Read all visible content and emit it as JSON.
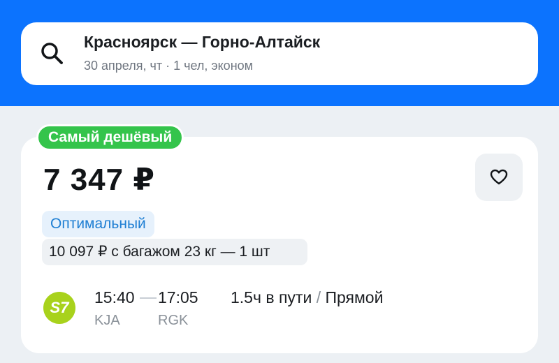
{
  "search": {
    "route": "Красноярск — Горно-Алтайск",
    "date": "30 апреля, чт",
    "separator": "·",
    "passengers": "1 чел, эконом"
  },
  "offer": {
    "badge": "Самый дешёвый",
    "price": "7 347 ₽",
    "tariff": "Оптимальный",
    "baggage_option": "10 097 ₽ с багажом 23 кг — 1 шт",
    "airline_logo_text": "S7",
    "departure_time": "15:40",
    "arrival_time": "17:05",
    "departure_code": "KJA",
    "arrival_code": "RGK",
    "duration": "1.5ч в пути",
    "slash": "/",
    "flight_type": "Прямой"
  },
  "colors": {
    "header_blue": "#0c73fe",
    "badge_green": "#34c44b",
    "tariff_blue": "#1f7fd3",
    "s7_green": "#a8d21c"
  },
  "icons": {
    "search": "search-icon",
    "favorite": "heart-icon"
  }
}
